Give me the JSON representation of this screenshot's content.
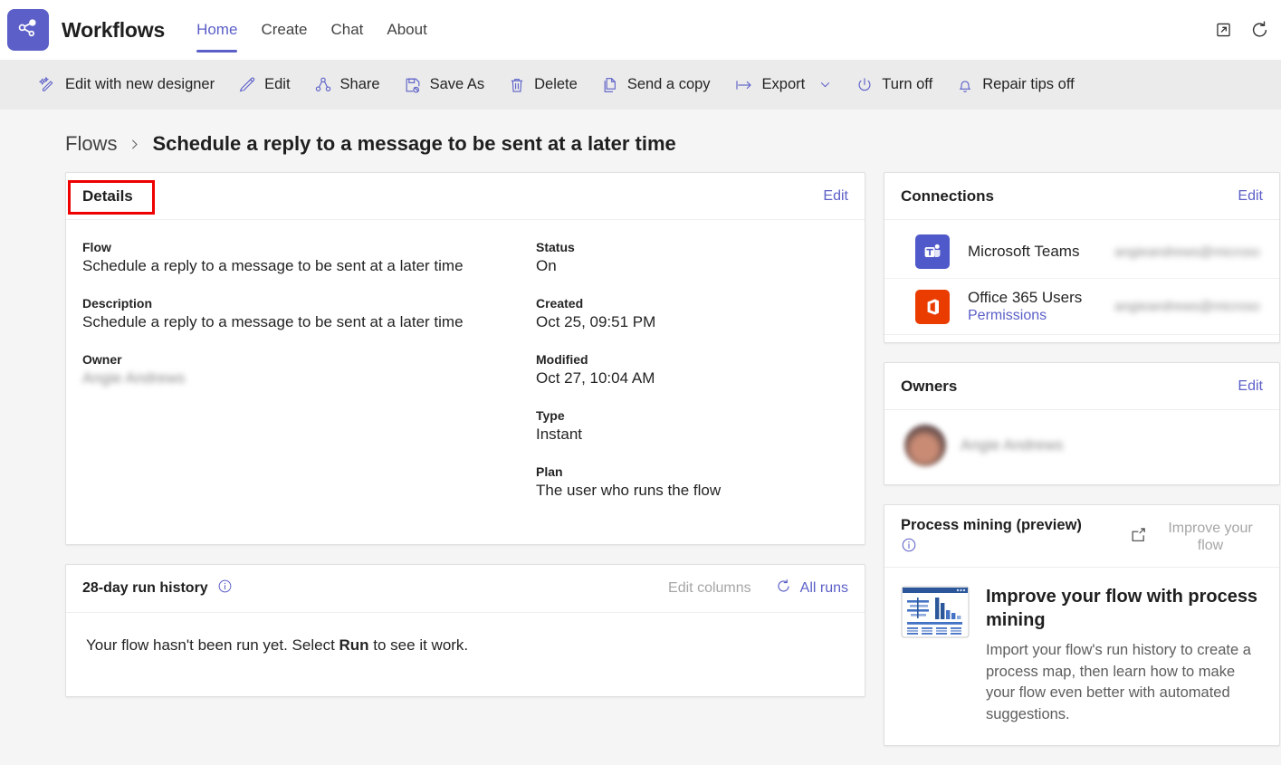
{
  "header": {
    "logo_icon": "share-nodes-icon",
    "app_title": "Workflows",
    "nav": [
      {
        "label": "Home",
        "active": true
      },
      {
        "label": "Create",
        "active": false
      },
      {
        "label": "Chat",
        "active": false
      },
      {
        "label": "About",
        "active": false
      }
    ],
    "popout_icon": "pop-out-icon",
    "refresh_icon": "refresh-icon"
  },
  "commandbar": {
    "items": [
      {
        "label": "Edit with new designer",
        "icon": "magic-wand-edit-icon",
        "caret": false
      },
      {
        "label": "Edit",
        "icon": "pencil-icon",
        "caret": false
      },
      {
        "label": "Share",
        "icon": "share-icon",
        "caret": false
      },
      {
        "label": "Save As",
        "icon": "save-as-icon",
        "caret": false
      },
      {
        "label": "Delete",
        "icon": "trash-icon",
        "caret": false
      },
      {
        "label": "Send a copy",
        "icon": "copy-icon",
        "caret": false
      },
      {
        "label": "Export",
        "icon": "export-arrow-icon",
        "caret": true
      },
      {
        "label": "Turn off",
        "icon": "power-icon",
        "caret": false
      },
      {
        "label": "Repair tips off",
        "icon": "bell-icon",
        "caret": false
      }
    ]
  },
  "breadcrumb": {
    "parent": "Flows",
    "separator_icon": "chevron-right-icon",
    "current": "Schedule a reply to a message to be sent at a later time"
  },
  "details": {
    "title": "Details",
    "edit_label": "Edit",
    "highlighted": true,
    "highlight_color": "#ee0000",
    "left_fields": [
      {
        "label": "Flow",
        "value": "Schedule a reply to a message to be sent at a later time",
        "redacted": false
      },
      {
        "label": "Description",
        "value": "Schedule a reply to a message to be sent at a later time",
        "redacted": false
      },
      {
        "label": "Owner",
        "value": "Angie Andrews",
        "redacted": true
      }
    ],
    "right_fields": [
      {
        "label": "Status",
        "value": "On",
        "redacted": false
      },
      {
        "label": "Created",
        "value": "Oct 25, 09:51 PM",
        "redacted": false
      },
      {
        "label": "Modified",
        "value": "Oct 27, 10:04 AM",
        "redacted": false
      },
      {
        "label": "Type",
        "value": "Instant",
        "redacted": false
      },
      {
        "label": "Plan",
        "value": "The user who runs the flow",
        "redacted": false
      }
    ]
  },
  "run_history": {
    "title": "28-day run history",
    "info_icon": "info-circle-icon",
    "edit_columns_label": "Edit columns",
    "refresh_icon": "refresh-circle-icon",
    "all_runs_label": "All runs",
    "empty_prefix": "Your flow hasn't been run yet. Select ",
    "empty_bold": "Run",
    "empty_suffix": " to see it work."
  },
  "connections": {
    "title": "Connections",
    "edit_label": "Edit",
    "items": [
      {
        "icon": "microsoft-teams-icon",
        "icon_color": "#5059c9",
        "name": "Microsoft Teams",
        "sub_label": "",
        "account": "angieandrews@microsoft.com",
        "account_redacted": true
      },
      {
        "icon": "office-365-icon",
        "icon_color": "#eb3c00",
        "name": "Office 365 Users",
        "sub_label": "Permissions",
        "account": "angieandrews@microsoft.com",
        "account_redacted": true
      }
    ]
  },
  "owners": {
    "title": "Owners",
    "edit_label": "Edit",
    "items": [
      {
        "avatar": "user-avatar",
        "name": "Angie Andrews",
        "redacted": true
      }
    ]
  },
  "process_mining": {
    "title": "Process mining (preview)",
    "info_icon": "info-circle-icon",
    "action_icon": "open-in-new-window-icon",
    "action_label": "Improve your flow",
    "action_disabled": true,
    "thumbnail_icon": "process-dashboard-icon",
    "heading": "Improve your flow with process mining",
    "body": "Import your flow's run history to create a process map, then learn how to make your flow even better with automated suggestions."
  },
  "theme": {
    "accent": "#5b5fc7",
    "page_bg": "#f5f5f5",
    "card_bg": "#ffffff",
    "cmdbar_bg": "#ebebeb"
  }
}
